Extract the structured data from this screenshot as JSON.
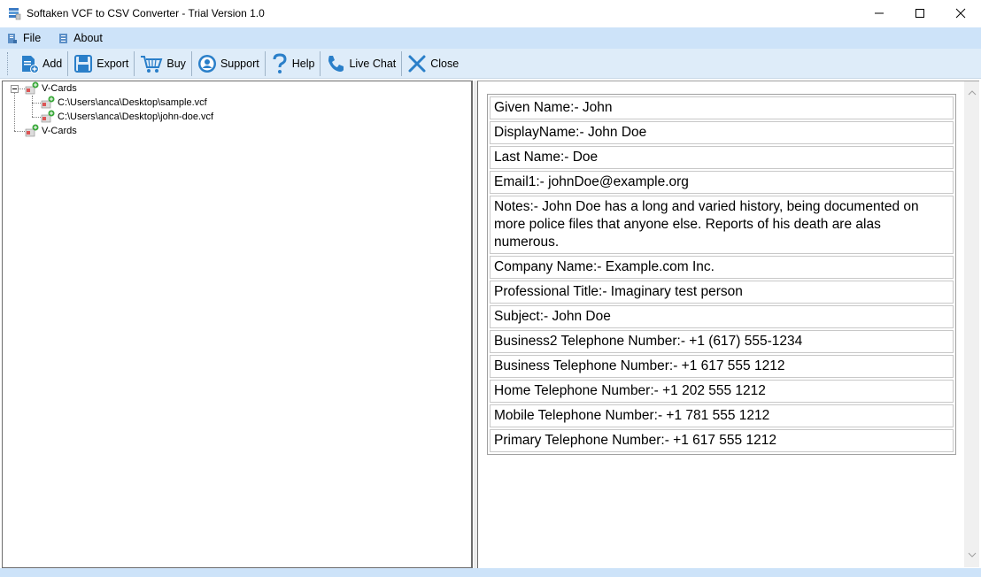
{
  "window": {
    "title": "Softaken VCF to CSV Converter - Trial Version 1.0"
  },
  "menu": {
    "items": [
      {
        "label": "File",
        "icon": "file-icon"
      },
      {
        "label": "About",
        "icon": "about-icon"
      }
    ]
  },
  "toolbar": {
    "add": "Add",
    "export": "Export",
    "buy": "Buy",
    "support": "Support",
    "help": "Help",
    "live_chat": "Live Chat",
    "close": "Close"
  },
  "tree": {
    "root1": "V-Cards",
    "files": [
      "C:\\Users\\anca\\Desktop\\sample.vcf",
      "C:\\Users\\anca\\Desktop\\john-doe.vcf"
    ],
    "root2": "V-Cards"
  },
  "details": [
    "Given Name:- John",
    "DisplayName:- John Doe",
    "Last Name:- Doe",
    "Email1:- johnDoe@example.org",
    "Notes:- John Doe has a long and varied history, being documented on more police files that anyone else. Reports of his death are alas numerous.",
    "Company Name:- Example.com Inc.",
    "Professional Title:- Imaginary test person",
    "Subject:- John Doe",
    "Business2 Telephone Number:- +1 (617) 555-1234",
    "Business Telephone Number:- +1 617 555 1212",
    "Home Telephone Number:- +1 202 555 1212",
    "Mobile Telephone Number:- +1 781 555 1212",
    "Primary Telephone Number:- +1 617 555 1212"
  ],
  "colors": {
    "menubar": "#cde3f9",
    "toolbar": "#deecf9",
    "icon_blue": "#2a7fc9"
  }
}
